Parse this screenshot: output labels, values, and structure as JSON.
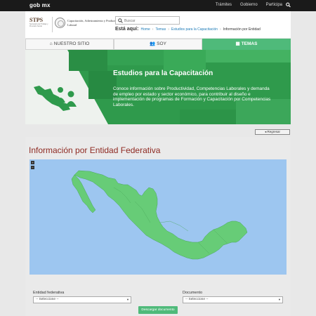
{
  "topbar": {
    "logo": "gob mx",
    "nav": [
      "Trámites",
      "Gobierno",
      "Participa"
    ],
    "search_icon": "search-icon"
  },
  "header": {
    "stps_title": "STPS",
    "stps_subtitle": "Secretaría del Trabajo y Previsión Social",
    "department": "Capacitación, Adiestramiento y Productividad Laboral",
    "search_placeholder": "Buscar",
    "breadcrumb_label": "Está aquí:",
    "breadcrumbs": [
      "Home",
      "Temas",
      "Estudios para la Capacitación",
      "Información por Entidad"
    ]
  },
  "tabs": [
    {
      "label": "NUESTRO SITIO",
      "icon": "home-icon",
      "active": false
    },
    {
      "label": "SOY",
      "icon": "users-icon",
      "active": false
    },
    {
      "label": "TEMAS",
      "icon": "grid-icon",
      "active": true
    }
  ],
  "banner": {
    "title": "Estudios para la Capacitación",
    "text": "Conoce información sobre Productividad, Competencias Laborales y demanda de empleo por estado y sector económico, para contribuir al diseño e implementación de programas de Formación y Capacitación por Competencias Laborales."
  },
  "back_button": "◂ Regresar",
  "page_title": "Información por Entidad Federativa",
  "map": {
    "zoom_in": "+",
    "zoom_out": "−"
  },
  "form": {
    "entidad_label": "Entidad federativa",
    "entidad_value": "-- Seleccione --",
    "documento_label": "Documento",
    "documento_value": "-- Seleccione --",
    "download_label": "Descargar documento"
  },
  "colors": {
    "accent": "#4fba7a",
    "title": "#8e2a22",
    "water": "#9dc6f0",
    "land": "#67cc77"
  }
}
